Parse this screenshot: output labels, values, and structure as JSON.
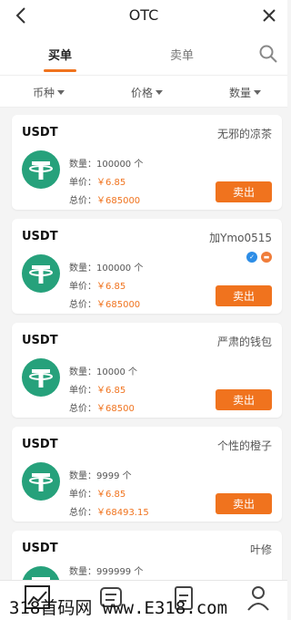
{
  "header": {
    "title": "OTC"
  },
  "tabs": {
    "buy": "买单",
    "sell": "卖单"
  },
  "filters": {
    "coin": "币种",
    "price": "价格",
    "quantity": "数量"
  },
  "colors": {
    "accent": "#f0731e",
    "tether": "#26a17b"
  },
  "labels": {
    "qty": "数量：",
    "unit_price": "单价：",
    "total": "总价：",
    "sell_button": "卖出"
  },
  "listings": [
    {
      "coin": "USDT",
      "seller": "无邪的凉茶",
      "qty": "100000 个",
      "price": "￥6.85",
      "total": "￥685000"
    },
    {
      "coin": "USDT",
      "seller": "加Ymo0515",
      "qty": "100000 个",
      "price": "￥6.85",
      "total": "￥685000"
    },
    {
      "coin": "USDT",
      "seller": "严肃的钱包",
      "qty": "10000 个",
      "price": "￥6.85",
      "total": "￥68500"
    },
    {
      "coin": "USDT",
      "seller": "个性的橙子",
      "qty": "9999 个",
      "price": "￥6.85",
      "total": "￥68493.15"
    },
    {
      "coin": "USDT",
      "seller": "叶修",
      "qty": "999999 个"
    }
  ],
  "badges": {
    "verified": "✓",
    "card": "▬"
  },
  "watermark": "318首码网 www.E318.com"
}
